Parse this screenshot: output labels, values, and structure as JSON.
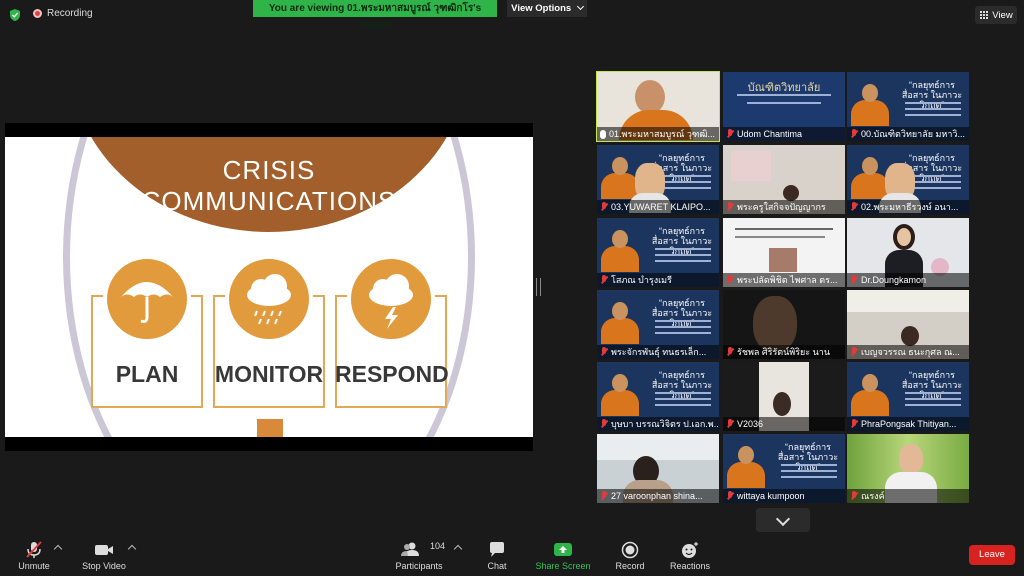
{
  "topbar": {
    "recording_label": "Recording",
    "viewing_banner": "You are viewing 01.พระมหาสมบูรณ์ วุฑฒิกโร's screen",
    "view_options_label": "View Options",
    "view_button_label": "View"
  },
  "slide": {
    "title_line1": "CRISIS",
    "title_line2": "COMMUNICATIONS",
    "cards": [
      "PLAN",
      "MONITOR",
      "RESPOND"
    ],
    "icons": [
      "umbrella-icon",
      "rain-cloud-icon",
      "storm-cloud-icon"
    ]
  },
  "gallery": {
    "participants": [
      {
        "name": "01.พระมหาสมบูรณ์ วุฑฒิ...",
        "kind": "monk-live",
        "active": true,
        "muted": false
      },
      {
        "name": "Udom Chantima",
        "kind": "graduate-poster",
        "muted": true
      },
      {
        "name": "00.บัณฑิตวิทยาลัย มหาวิ...",
        "kind": "poster",
        "muted": true
      },
      {
        "name": "03.YUWARET KLAIPO...",
        "kind": "poster-face",
        "muted": true
      },
      {
        "name": "พระครูใสกิจจปัญญากร",
        "kind": "room",
        "muted": true
      },
      {
        "name": "02.พระมหาธีรวงษ์ อนา...",
        "kind": "poster-face",
        "muted": true
      },
      {
        "name": "โสภณ บำรุงเมรี",
        "kind": "poster",
        "muted": true
      },
      {
        "name": "พระปลัดพิชิต ไพศาล ตร...",
        "kind": "document",
        "muted": true
      },
      {
        "name": "Dr.Doungkamon",
        "kind": "woman",
        "muted": true
      },
      {
        "name": "พระจักรพันธุ์ ทนธรเล็ก...",
        "kind": "poster",
        "muted": true
      },
      {
        "name": "รัชพล ศิริรัตน์พิริยะ นาน",
        "kind": "dark-face",
        "muted": true
      },
      {
        "name": "เบญจวรรณ ธนะกุศล ณ...",
        "kind": "office",
        "muted": true
      },
      {
        "name": "บุษบา บรรณวิจิตร ป.เอก.พ...",
        "kind": "poster",
        "muted": true
      },
      {
        "name": "V2036",
        "kind": "office2",
        "muted": true
      },
      {
        "name": "PhraPongsak Thitiyan...",
        "kind": "poster",
        "muted": true
      },
      {
        "name": "27 varoonphan shina...",
        "kind": "outdoor",
        "muted": true
      },
      {
        "name": "wittaya kumpoon",
        "kind": "poster",
        "muted": true
      },
      {
        "name": "ณรงค์",
        "kind": "man-green",
        "muted": true
      }
    ],
    "poster_title": "“กลยุทธ์การสื่อสาร ในภาวะวิกฤต”",
    "graduate_title": "บัณฑิตวิทยาลัย"
  },
  "toolbar": {
    "unmute_label": "Unmute",
    "stop_video_label": "Stop Video",
    "participants_label": "Participants",
    "participants_count": "104",
    "chat_label": "Chat",
    "share_screen_label": "Share Screen",
    "record_label": "Record",
    "reactions_label": "Reactions",
    "leave_label": "Leave"
  },
  "colors": {
    "share_green": "#2fb44a",
    "leave_red": "#d7231f",
    "slide_brown": "#a25f2b",
    "slide_orange": "#e19a3c"
  }
}
